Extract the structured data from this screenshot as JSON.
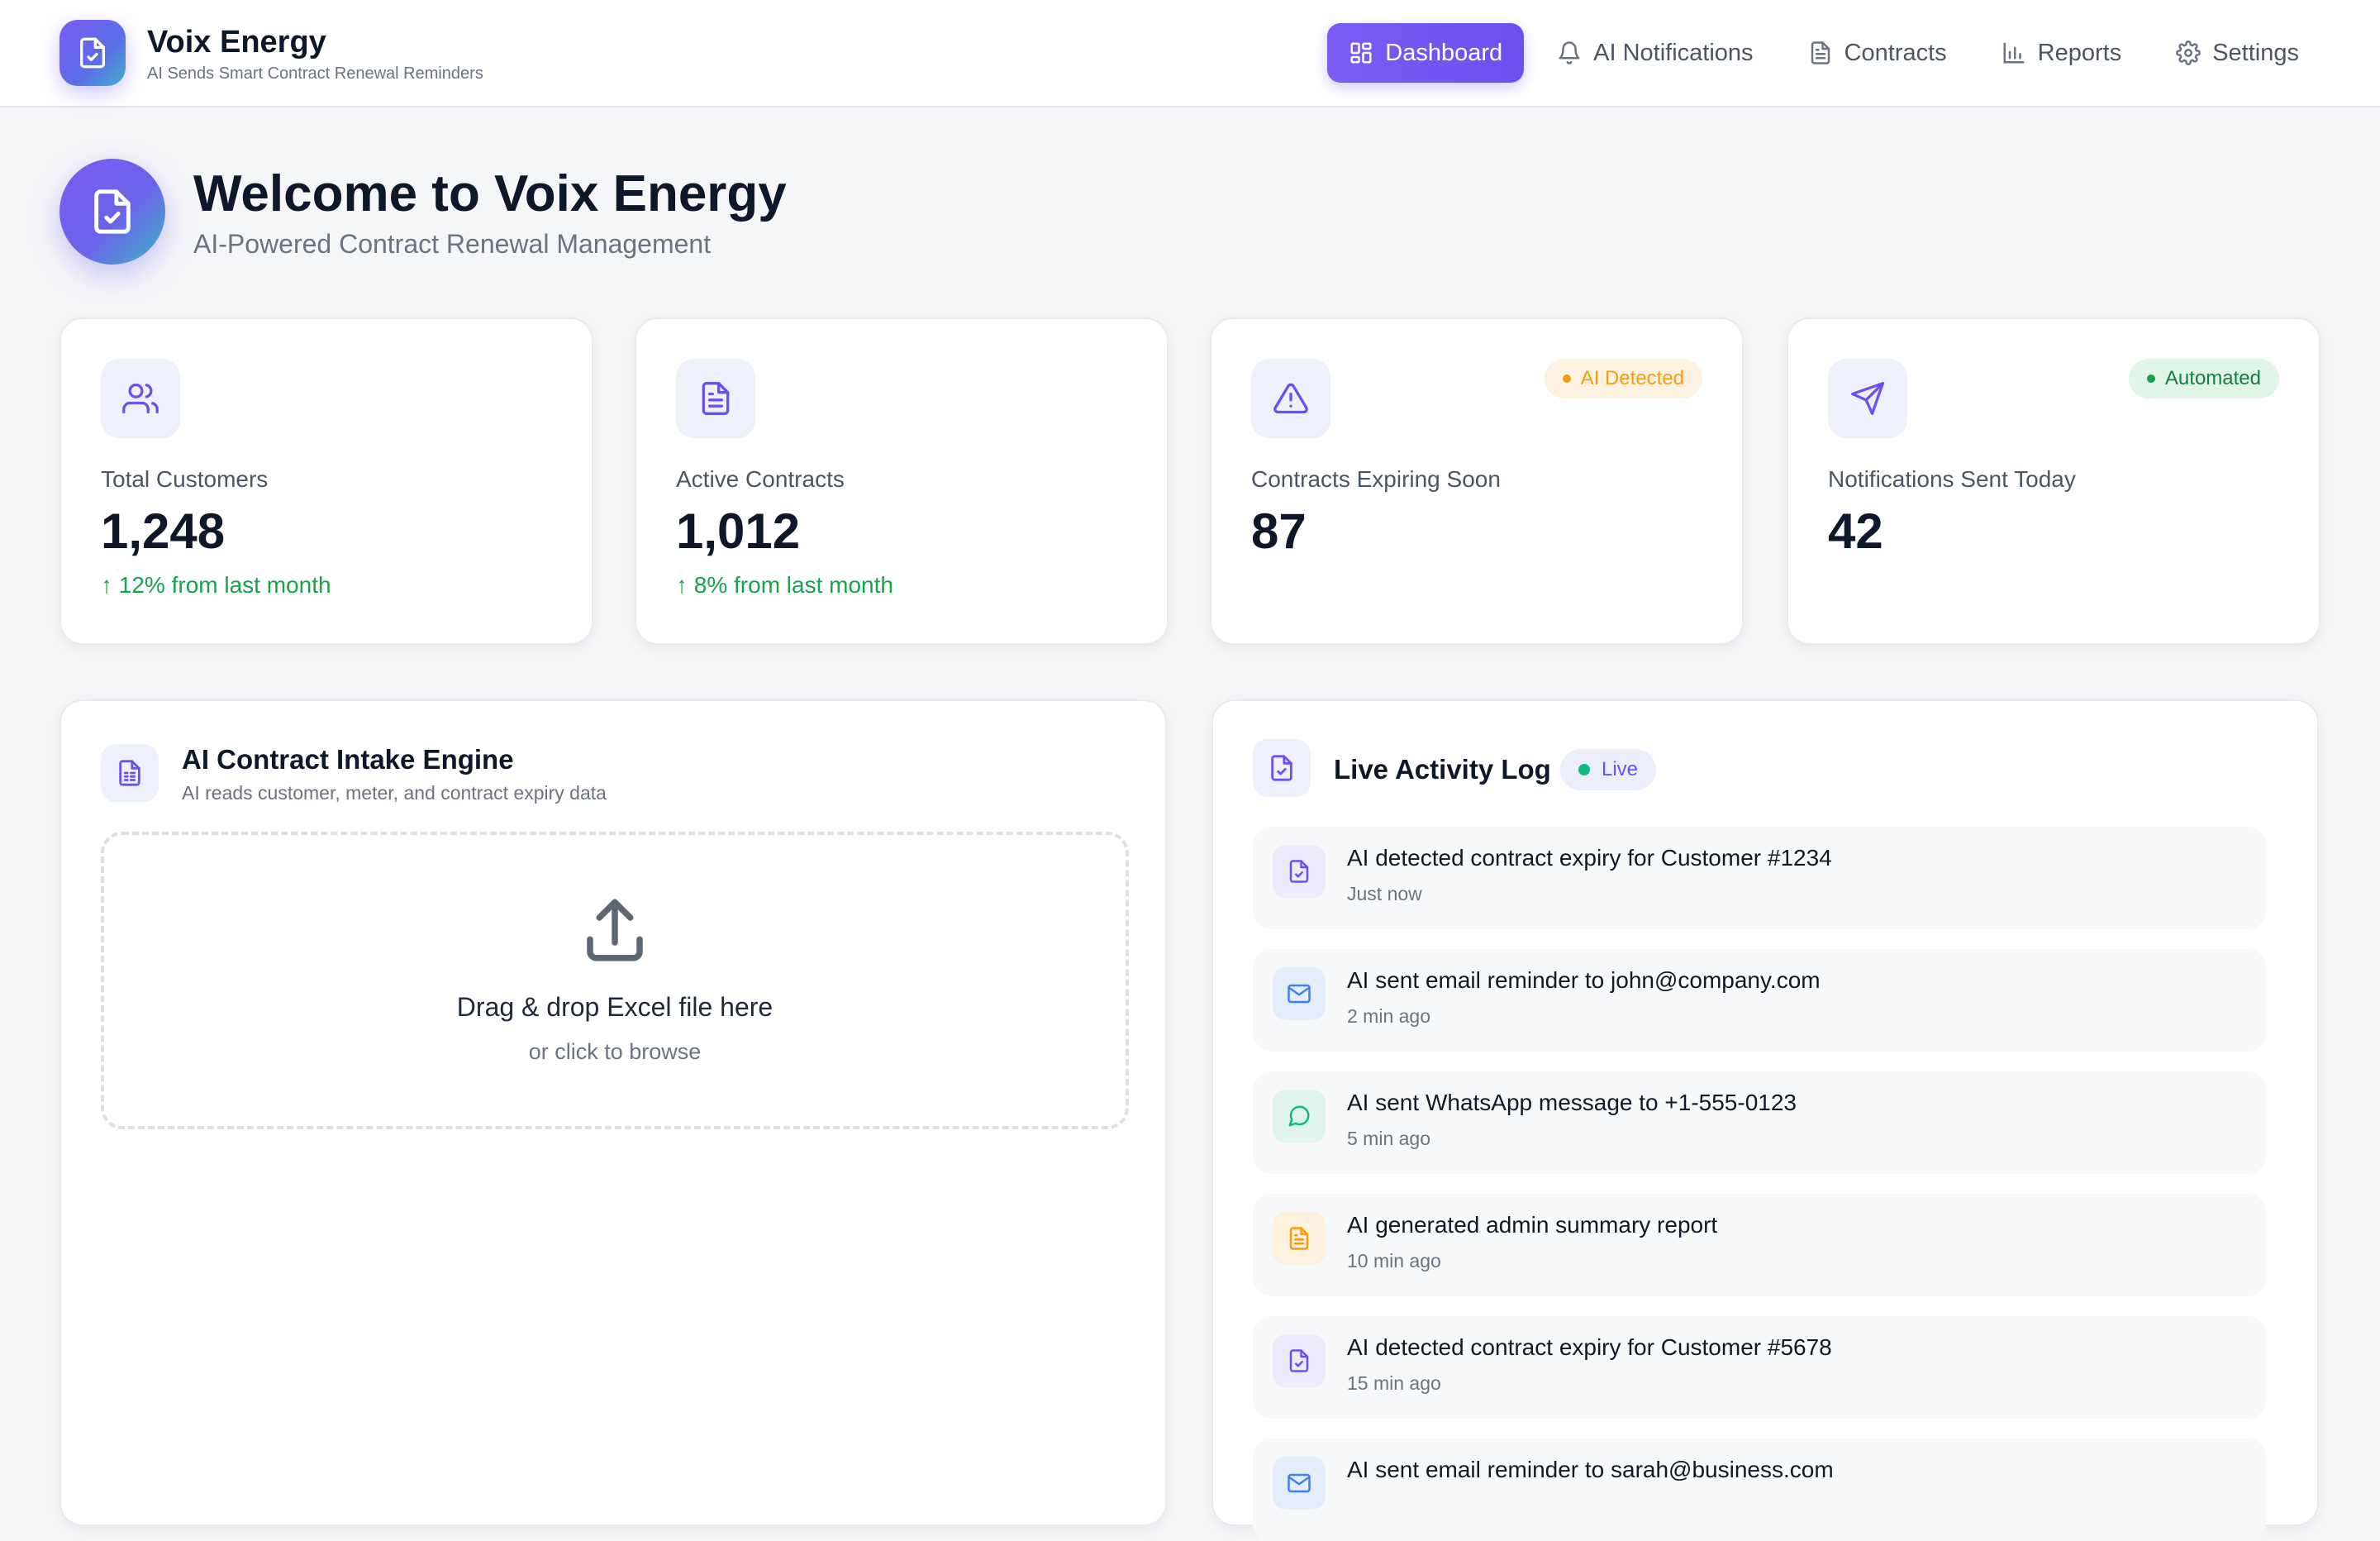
{
  "brand": {
    "name": "Voix Energy",
    "tagline": "AI Sends Smart Contract Renewal Reminders"
  },
  "nav": [
    {
      "label": "Dashboard",
      "icon": "dashboard-icon",
      "active": true
    },
    {
      "label": "AI Notifications",
      "icon": "bell-icon",
      "active": false
    },
    {
      "label": "Contracts",
      "icon": "document-icon",
      "active": false
    },
    {
      "label": "Reports",
      "icon": "bar-chart-icon",
      "active": false
    },
    {
      "label": "Settings",
      "icon": "gear-icon",
      "active": false
    }
  ],
  "welcome": {
    "title": "Welcome to Voix Energy",
    "subtitle": "AI-Powered Contract Renewal Management"
  },
  "stats": [
    {
      "label": "Total Customers",
      "value": "1,248",
      "trend": "↑ 12% from last month",
      "icon": "users-icon"
    },
    {
      "label": "Active Contracts",
      "value": "1,012",
      "trend": "↑ 8% from last month",
      "icon": "document-icon"
    },
    {
      "label": "Contracts Expiring Soon",
      "value": "87",
      "badge": "AI Detected",
      "icon": "warning-icon"
    },
    {
      "label": "Notifications Sent Today",
      "value": "42",
      "badge": "Automated",
      "icon": "send-icon"
    }
  ],
  "intake": {
    "title": "AI Contract Intake Engine",
    "subtitle": "AI reads customer, meter, and contract expiry data",
    "drop_main": "Drag & drop Excel file here",
    "drop_sub": "or click to browse"
  },
  "activity": {
    "title": "Live Activity Log",
    "badge": "Live",
    "items": [
      {
        "text": "AI detected contract expiry for Customer #1234",
        "time": "Just now",
        "icon": "file-check-icon"
      },
      {
        "text": "AI sent email reminder to john@company.com",
        "time": "2 min ago",
        "icon": "mail-icon"
      },
      {
        "text": "AI sent WhatsApp message to +1-555-0123",
        "time": "5 min ago",
        "icon": "chat-icon"
      },
      {
        "text": "AI generated admin summary report",
        "time": "10 min ago",
        "icon": "report-icon"
      },
      {
        "text": "AI detected contract expiry for Customer #5678",
        "time": "15 min ago",
        "icon": "file-check-icon"
      },
      {
        "text": "AI sent email reminder to sarah@business.com",
        "time": "",
        "icon": "mail-icon"
      }
    ]
  },
  "colors": {
    "accent": "#6d4ff0",
    "success": "#16a34a",
    "warning": "#f59e0b",
    "background": "#f5f6f8"
  }
}
